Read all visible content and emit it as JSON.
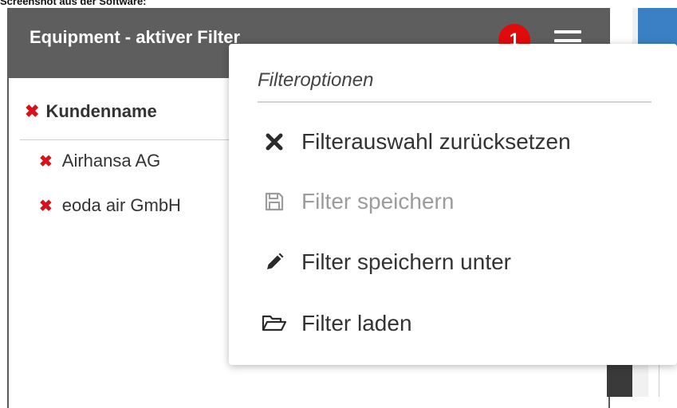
{
  "caption": "Screenshot aus der Software:",
  "panel": {
    "title": "Equipment - aktiver Filter",
    "badge_count": "1",
    "filter_name": "Kundenname",
    "filter_values": [
      "Airhansa AG",
      "eoda air GmbH"
    ]
  },
  "menu": {
    "heading": "Filteroptionen",
    "items": [
      {
        "label": "Filterauswahl zurücksetzen",
        "icon": "close-icon",
        "enabled": true
      },
      {
        "label": "Filter speichern",
        "icon": "floppy-disk-icon",
        "enabled": false
      },
      {
        "label": "Filter speichern unter",
        "icon": "pencil-icon",
        "enabled": true
      },
      {
        "label": "Filter laden",
        "icon": "folder-open-icon",
        "enabled": true
      }
    ]
  },
  "colors": {
    "header": "#5e5e5e",
    "badge": "#e00b0b",
    "remove_x": "#d8121b",
    "right_panel_accent": "#3b7fc4"
  }
}
